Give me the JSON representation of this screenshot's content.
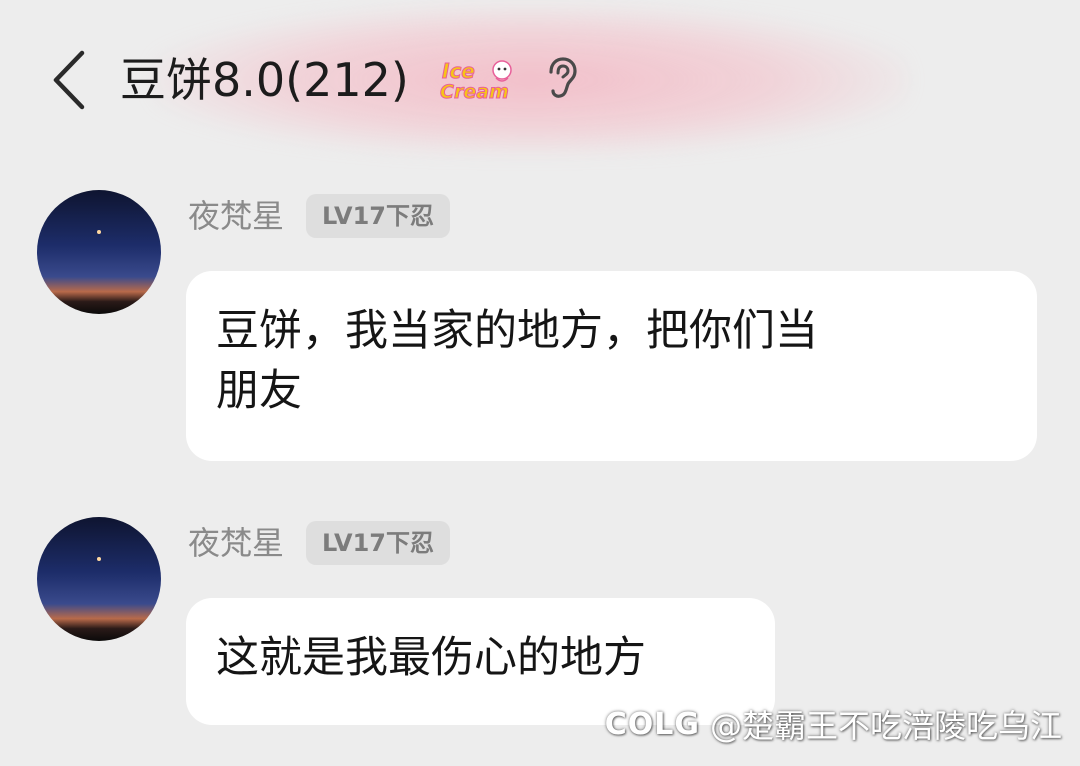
{
  "header": {
    "title": "豆饼8.0(212)",
    "badge_icon": "ice-cream-badge-icon",
    "badge_text": "Ice Cream",
    "ear_icon": "ear-icon",
    "back_icon": "chevron-left-icon"
  },
  "messages": [
    {
      "sender": "夜梵星",
      "level": "LV17下忍",
      "lines": [
        "豆饼，我当家的地方，把你们当",
        "朋友"
      ]
    },
    {
      "sender": "夜梵星",
      "level": "LV17下忍",
      "lines": [
        "这就是我最伤心的地方"
      ]
    }
  ],
  "watermark": {
    "logo": "COLG",
    "text": "@楚霸王不吃涪陵吃乌江"
  },
  "colors": {
    "background": "#ededed",
    "bubble": "#ffffff",
    "header_glow": "#f4b0be",
    "badge_bg": "#dedede",
    "icecream_yellow": "#f7c417",
    "icecream_pink": "#e8609a"
  }
}
